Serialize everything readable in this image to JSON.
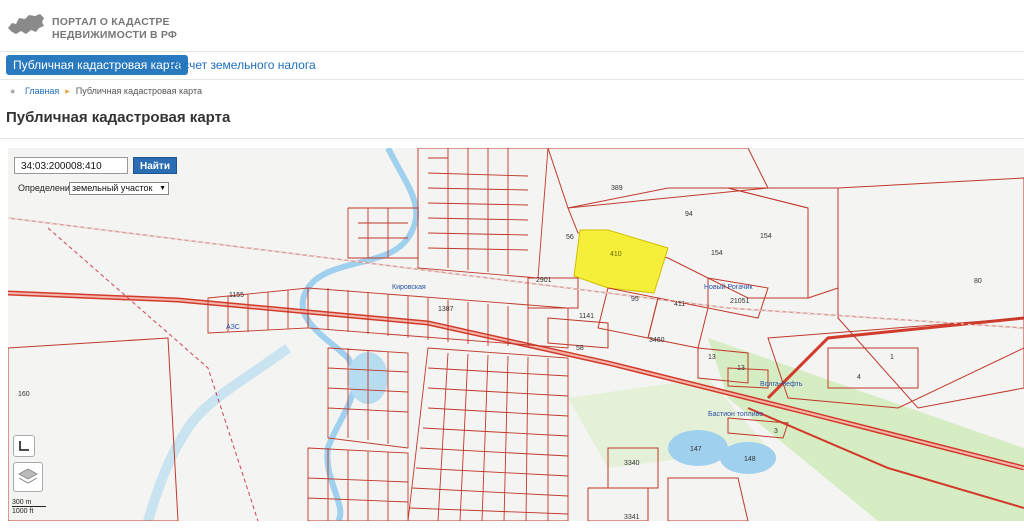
{
  "header": {
    "portal_line1": "ПОРТАЛ О КАДАСТРЕ",
    "portal_line2": "НЕДВИЖИМОСТИ В РФ",
    "logo_icon": "russia-map-icon"
  },
  "nav": {
    "tab_active": "Публичная кадастровая карта",
    "tab_tax": "Расчет земельного налога"
  },
  "breadcrumb": {
    "home": "Главная",
    "current": "Публичная кадастровая карта"
  },
  "page_title": "Публичная кадастровая карта",
  "search": {
    "value": "34:03:200008:410",
    "button": "Найти"
  },
  "definition": {
    "label": "Определение:",
    "selected": "земельный участок"
  },
  "scale": {
    "metric": "300 m",
    "imperial": "1000 ft"
  },
  "map_labels": {
    "parcel_selected": "410",
    "p389": "389",
    "p94": "94",
    "p154_a": "154",
    "p154_b": "154",
    "p56": "56",
    "p2901": "2901",
    "p95": "95",
    "p411": "411",
    "p21051": "21051",
    "p1141": "1141",
    "p3460": "3460",
    "p13a": "13",
    "p13b": "13",
    "p80": "80",
    "p4": "4",
    "p1": "1",
    "p160": "160",
    "p147": "147",
    "p148": "148",
    "p3340": "3340",
    "p3341": "3341",
    "p3": "3",
    "p1155": "1155",
    "p58": "58",
    "p1387": "1387",
    "station": "Новый Рогачик",
    "street_kirov": "Кировская",
    "azs": "АЗС",
    "oil": "Волга-Нефть",
    "fuel": "Бастион топливо"
  },
  "colors": {
    "accent": "#2a7ac0",
    "parcel_line": "#c0392b",
    "selected_parcel": "#f6ef3a",
    "water": "#b7dcf0",
    "green": "#cfe9b8"
  }
}
